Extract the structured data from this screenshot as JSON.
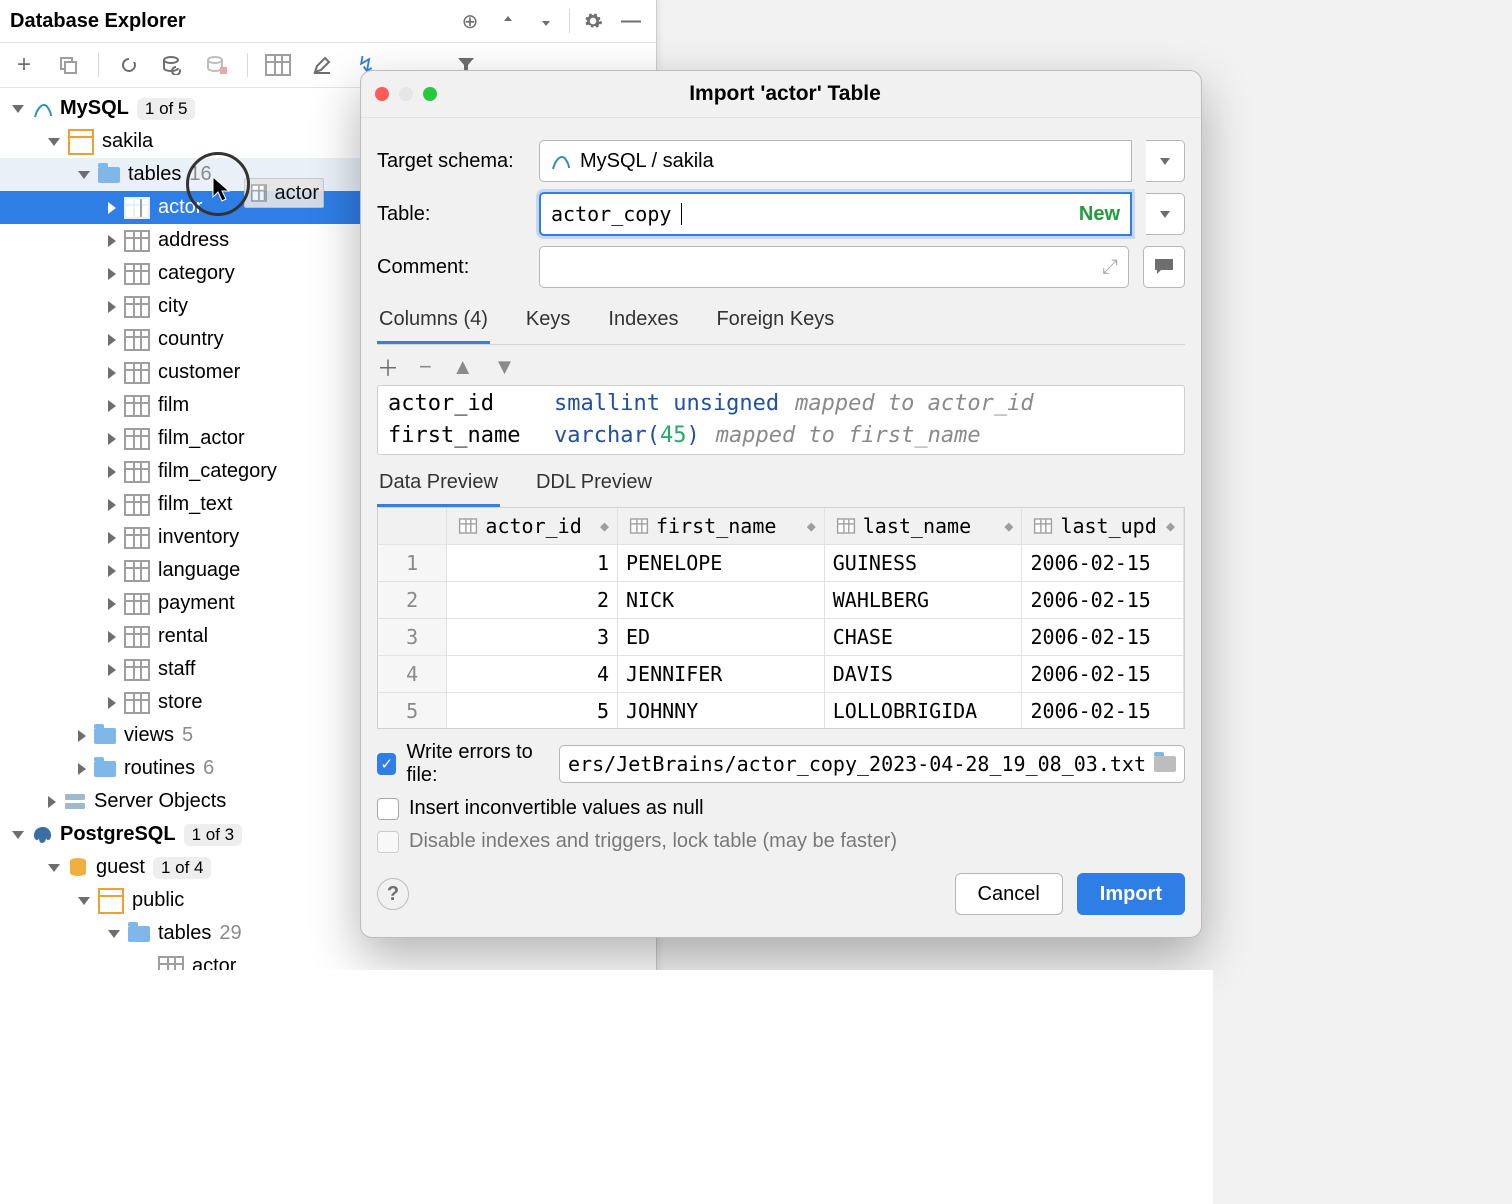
{
  "panel": {
    "title": "Database Explorer",
    "root_mysql_label": "MySQL",
    "root_mysql_badge": "1 of 5",
    "schema_sakila": "sakila",
    "tables_label": "tables",
    "tables_count": "16",
    "drag_label": "actor",
    "tables": [
      "actor",
      "address",
      "category",
      "city",
      "country",
      "customer",
      "film",
      "film_actor",
      "film_category",
      "film_text",
      "inventory",
      "language",
      "payment",
      "rental",
      "staff",
      "store"
    ],
    "views_label": "views",
    "views_count": "5",
    "routines_label": "routines",
    "routines_count": "6",
    "server_objects": "Server Objects",
    "root_pg_label": "PostgreSQL",
    "root_pg_badge": "1 of 3",
    "pg_db": "guest",
    "pg_db_badge": "1 of 4",
    "pg_schema": "public",
    "pg_tables_label": "tables",
    "pg_tables_count": "29",
    "pg_table_actor": "actor"
  },
  "dialog": {
    "title": "Import 'actor' Table",
    "target_schema_label": "Target schema:",
    "target_schema_value": "MySQL / sakila",
    "table_label": "Table:",
    "table_value": "actor_copy",
    "table_new": "New",
    "comment_label": "Comment:",
    "tabs": {
      "columns": "Columns (4)",
      "keys": "Keys",
      "indexes": "Indexes",
      "fks": "Foreign Keys"
    },
    "columns": [
      {
        "name": "actor_id",
        "type": "smallint unsigned",
        "map": "mapped to actor_id"
      },
      {
        "name": "first_name",
        "type": "varchar(45)",
        "map": "mapped to first_name"
      }
    ],
    "preview_tabs": {
      "data": "Data Preview",
      "ddl": "DDL Preview"
    },
    "grid_headers": [
      "actor_id",
      "first_name",
      "last_name",
      "last_upd"
    ],
    "grid_rows": [
      {
        "n": "1",
        "id": "1",
        "fn": "PENELOPE",
        "ln": "GUINESS",
        "lu": "2006-02-15"
      },
      {
        "n": "2",
        "id": "2",
        "fn": "NICK",
        "ln": "WAHLBERG",
        "lu": "2006-02-15"
      },
      {
        "n": "3",
        "id": "3",
        "fn": "ED",
        "ln": "CHASE",
        "lu": "2006-02-15"
      },
      {
        "n": "4",
        "id": "4",
        "fn": "JENNIFER",
        "ln": "DAVIS",
        "lu": "2006-02-15"
      },
      {
        "n": "5",
        "id": "5",
        "fn": "JOHNNY",
        "ln": "LOLLOBRIGIDA",
        "lu": "2006-02-15"
      }
    ],
    "write_errors_label": "Write errors to file:",
    "write_errors_path": "ers/JetBrains/actor_copy_2023-04-28_19_08_03.txt",
    "insert_null_label": "Insert inconvertible values as null",
    "disable_idx_label": "Disable indexes and triggers, lock table (may be faster)",
    "cancel": "Cancel",
    "import": "Import"
  }
}
